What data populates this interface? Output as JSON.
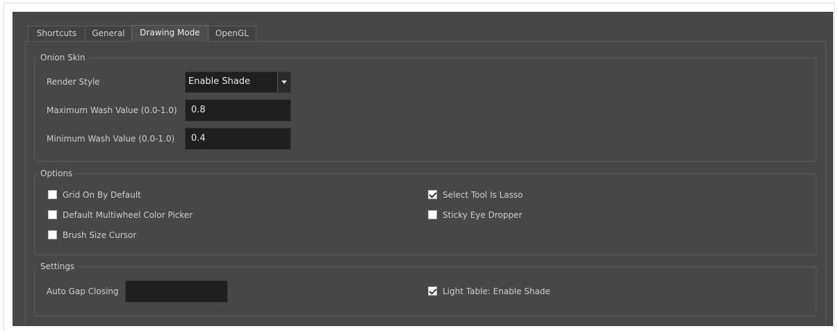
{
  "tabs": [
    {
      "label": "Shortcuts",
      "active": false
    },
    {
      "label": "General",
      "active": false
    },
    {
      "label": "Drawing Mode",
      "active": true
    },
    {
      "label": "OpenGL",
      "active": false
    }
  ],
  "onion_skin": {
    "title": "Onion Skin",
    "render_style": {
      "label": "Render Style",
      "value": "Enable Shade"
    },
    "max_wash": {
      "label": "Maximum Wash Value (0.0-1.0)",
      "value": "0.8"
    },
    "min_wash": {
      "label": "Minimum Wash Value (0.0-1.0)",
      "value": "0.4"
    }
  },
  "options": {
    "title": "Options",
    "left": [
      {
        "label": "Grid On By Default",
        "checked": false
      },
      {
        "label": "Default Multiwheel Color Picker",
        "checked": false
      },
      {
        "label": "Brush Size Cursor",
        "checked": false
      }
    ],
    "right": [
      {
        "label": "Select Tool Is Lasso",
        "checked": true
      },
      {
        "label": "Sticky Eye Dropper",
        "checked": false
      }
    ]
  },
  "settings": {
    "title": "Settings",
    "auto_gap": {
      "label": "Auto Gap Closing",
      "value": ""
    },
    "light_table": {
      "label": "Light Table: Enable Shade",
      "checked": true
    }
  },
  "colors": {
    "window_bg": "#474747",
    "field_bg": "#1f1f1f",
    "text": "#cdcdcd"
  }
}
